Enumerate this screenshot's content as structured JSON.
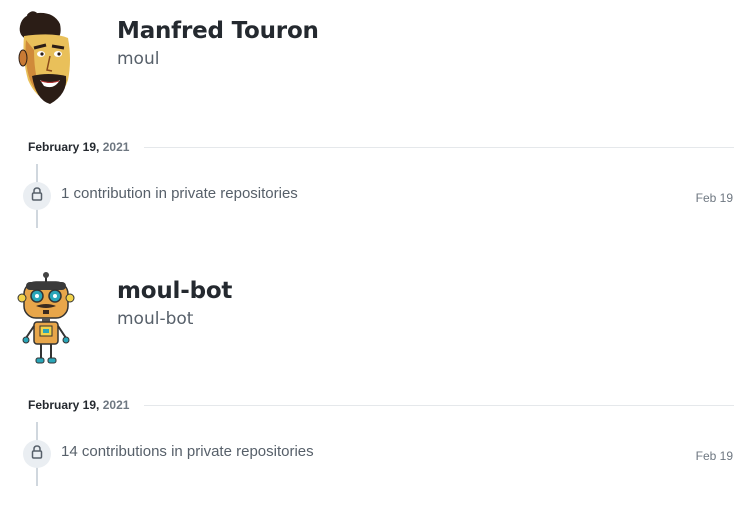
{
  "users": [
    {
      "full_name": "Manfred Touron",
      "login": "moul",
      "date_month_day": "February 19,",
      "date_year": "2021",
      "contribution_count": "1",
      "contribution_text": "contribution in private repositories",
      "contribution_date": "Feb 19"
    },
    {
      "full_name": "moul-bot",
      "login": "moul-bot",
      "date_month_day": "February 19,",
      "date_year": "2021",
      "contribution_count": "14",
      "contribution_text": "contributions in private repositories",
      "contribution_date": "Feb 19"
    }
  ],
  "icons": {
    "lock": "lock-icon",
    "avatar1": "avatar",
    "avatar2": "robot-avatar"
  },
  "colors": {
    "text": "#24292f",
    "muted": "#57606a",
    "timeline": "#d0d7de",
    "badge": "#eaeef2"
  }
}
